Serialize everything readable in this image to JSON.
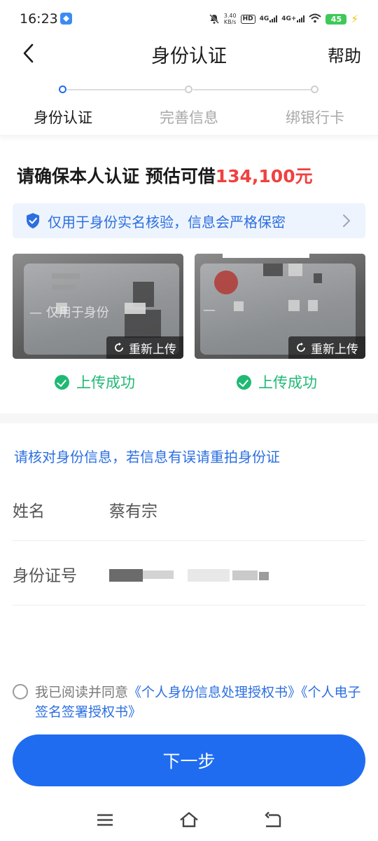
{
  "status_bar": {
    "time": "16:23",
    "net_speed_value": "3.40",
    "net_speed_unit": "KB/s",
    "hd_label": "HD",
    "sig1_label": "4G",
    "sig2_label": "4G+",
    "battery": "45"
  },
  "header": {
    "title": "身份认证",
    "help": "帮助"
  },
  "steps": [
    {
      "label": "身份认证",
      "active": true
    },
    {
      "label": "完善信息",
      "active": false
    },
    {
      "label": "绑银行卡",
      "active": false
    }
  ],
  "headline": {
    "prefix": "请确保本人认证 预估可借",
    "amount": "134,100元"
  },
  "notice": {
    "text": "仅用于身份实名核验，信息会严格保密"
  },
  "id_cards": [
    {
      "watermark": "— 仅用于身份",
      "reupload": "重新上传",
      "status": "上传成功"
    },
    {
      "watermark": "—",
      "reupload": "重新上传",
      "status": "上传成功"
    }
  ],
  "verify_hint": "请核对身份信息，若信息有误请重拍身份证",
  "fields": [
    {
      "label": "姓名",
      "value": "蔡有宗"
    },
    {
      "label": "身份证号",
      "value": ""
    }
  ],
  "agreement": {
    "prefix": "我已阅读并同意",
    "link1": "《个人身份信息处理授权书》",
    "link2": "《个人电子签名签署授权书》"
  },
  "next_button": "下一步",
  "colors": {
    "primary": "#1f6cf0",
    "amount": "#f04140",
    "success": "#1fb974",
    "notice_bg": "#eef4fd"
  }
}
